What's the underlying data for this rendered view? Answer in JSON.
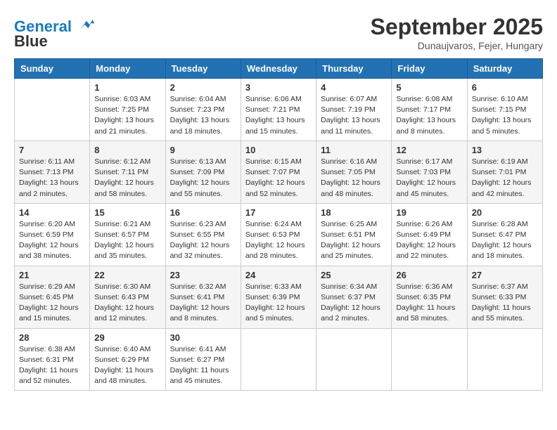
{
  "logo": {
    "line1": "General",
    "line2": "Blue"
  },
  "title": "September 2025",
  "subtitle": "Dunaujvaros, Fejer, Hungary",
  "weekdays": [
    "Sunday",
    "Monday",
    "Tuesday",
    "Wednesday",
    "Thursday",
    "Friday",
    "Saturday"
  ],
  "weeks": [
    [
      {
        "day": "",
        "sunrise": "",
        "sunset": "",
        "daylight": ""
      },
      {
        "day": "1",
        "sunrise": "Sunrise: 6:03 AM",
        "sunset": "Sunset: 7:25 PM",
        "daylight": "Daylight: 13 hours and 21 minutes."
      },
      {
        "day": "2",
        "sunrise": "Sunrise: 6:04 AM",
        "sunset": "Sunset: 7:23 PM",
        "daylight": "Daylight: 13 hours and 18 minutes."
      },
      {
        "day": "3",
        "sunrise": "Sunrise: 6:06 AM",
        "sunset": "Sunset: 7:21 PM",
        "daylight": "Daylight: 13 hours and 15 minutes."
      },
      {
        "day": "4",
        "sunrise": "Sunrise: 6:07 AM",
        "sunset": "Sunset: 7:19 PM",
        "daylight": "Daylight: 13 hours and 11 minutes."
      },
      {
        "day": "5",
        "sunrise": "Sunrise: 6:08 AM",
        "sunset": "Sunset: 7:17 PM",
        "daylight": "Daylight: 13 hours and 8 minutes."
      },
      {
        "day": "6",
        "sunrise": "Sunrise: 6:10 AM",
        "sunset": "Sunset: 7:15 PM",
        "daylight": "Daylight: 13 hours and 5 minutes."
      }
    ],
    [
      {
        "day": "7",
        "sunrise": "Sunrise: 6:11 AM",
        "sunset": "Sunset: 7:13 PM",
        "daylight": "Daylight: 13 hours and 2 minutes."
      },
      {
        "day": "8",
        "sunrise": "Sunrise: 6:12 AM",
        "sunset": "Sunset: 7:11 PM",
        "daylight": "Daylight: 12 hours and 58 minutes."
      },
      {
        "day": "9",
        "sunrise": "Sunrise: 6:13 AM",
        "sunset": "Sunset: 7:09 PM",
        "daylight": "Daylight: 12 hours and 55 minutes."
      },
      {
        "day": "10",
        "sunrise": "Sunrise: 6:15 AM",
        "sunset": "Sunset: 7:07 PM",
        "daylight": "Daylight: 12 hours and 52 minutes."
      },
      {
        "day": "11",
        "sunrise": "Sunrise: 6:16 AM",
        "sunset": "Sunset: 7:05 PM",
        "daylight": "Daylight: 12 hours and 48 minutes."
      },
      {
        "day": "12",
        "sunrise": "Sunrise: 6:17 AM",
        "sunset": "Sunset: 7:03 PM",
        "daylight": "Daylight: 12 hours and 45 minutes."
      },
      {
        "day": "13",
        "sunrise": "Sunrise: 6:19 AM",
        "sunset": "Sunset: 7:01 PM",
        "daylight": "Daylight: 12 hours and 42 minutes."
      }
    ],
    [
      {
        "day": "14",
        "sunrise": "Sunrise: 6:20 AM",
        "sunset": "Sunset: 6:59 PM",
        "daylight": "Daylight: 12 hours and 38 minutes."
      },
      {
        "day": "15",
        "sunrise": "Sunrise: 6:21 AM",
        "sunset": "Sunset: 6:57 PM",
        "daylight": "Daylight: 12 hours and 35 minutes."
      },
      {
        "day": "16",
        "sunrise": "Sunrise: 6:23 AM",
        "sunset": "Sunset: 6:55 PM",
        "daylight": "Daylight: 12 hours and 32 minutes."
      },
      {
        "day": "17",
        "sunrise": "Sunrise: 6:24 AM",
        "sunset": "Sunset: 6:53 PM",
        "daylight": "Daylight: 12 hours and 28 minutes."
      },
      {
        "day": "18",
        "sunrise": "Sunrise: 6:25 AM",
        "sunset": "Sunset: 6:51 PM",
        "daylight": "Daylight: 12 hours and 25 minutes."
      },
      {
        "day": "19",
        "sunrise": "Sunrise: 6:26 AM",
        "sunset": "Sunset: 6:49 PM",
        "daylight": "Daylight: 12 hours and 22 minutes."
      },
      {
        "day": "20",
        "sunrise": "Sunrise: 6:28 AM",
        "sunset": "Sunset: 6:47 PM",
        "daylight": "Daylight: 12 hours and 18 minutes."
      }
    ],
    [
      {
        "day": "21",
        "sunrise": "Sunrise: 6:29 AM",
        "sunset": "Sunset: 6:45 PM",
        "daylight": "Daylight: 12 hours and 15 minutes."
      },
      {
        "day": "22",
        "sunrise": "Sunrise: 6:30 AM",
        "sunset": "Sunset: 6:43 PM",
        "daylight": "Daylight: 12 hours and 12 minutes."
      },
      {
        "day": "23",
        "sunrise": "Sunrise: 6:32 AM",
        "sunset": "Sunset: 6:41 PM",
        "daylight": "Daylight: 12 hours and 8 minutes."
      },
      {
        "day": "24",
        "sunrise": "Sunrise: 6:33 AM",
        "sunset": "Sunset: 6:39 PM",
        "daylight": "Daylight: 12 hours and 5 minutes."
      },
      {
        "day": "25",
        "sunrise": "Sunrise: 6:34 AM",
        "sunset": "Sunset: 6:37 PM",
        "daylight": "Daylight: 12 hours and 2 minutes."
      },
      {
        "day": "26",
        "sunrise": "Sunrise: 6:36 AM",
        "sunset": "Sunset: 6:35 PM",
        "daylight": "Daylight: 11 hours and 58 minutes."
      },
      {
        "day": "27",
        "sunrise": "Sunrise: 6:37 AM",
        "sunset": "Sunset: 6:33 PM",
        "daylight": "Daylight: 11 hours and 55 minutes."
      }
    ],
    [
      {
        "day": "28",
        "sunrise": "Sunrise: 6:38 AM",
        "sunset": "Sunset: 6:31 PM",
        "daylight": "Daylight: 11 hours and 52 minutes."
      },
      {
        "day": "29",
        "sunrise": "Sunrise: 6:40 AM",
        "sunset": "Sunset: 6:29 PM",
        "daylight": "Daylight: 11 hours and 48 minutes."
      },
      {
        "day": "30",
        "sunrise": "Sunrise: 6:41 AM",
        "sunset": "Sunset: 6:27 PM",
        "daylight": "Daylight: 11 hours and 45 minutes."
      },
      {
        "day": "",
        "sunrise": "",
        "sunset": "",
        "daylight": ""
      },
      {
        "day": "",
        "sunrise": "",
        "sunset": "",
        "daylight": ""
      },
      {
        "day": "",
        "sunrise": "",
        "sunset": "",
        "daylight": ""
      },
      {
        "day": "",
        "sunrise": "",
        "sunset": "",
        "daylight": ""
      }
    ]
  ]
}
